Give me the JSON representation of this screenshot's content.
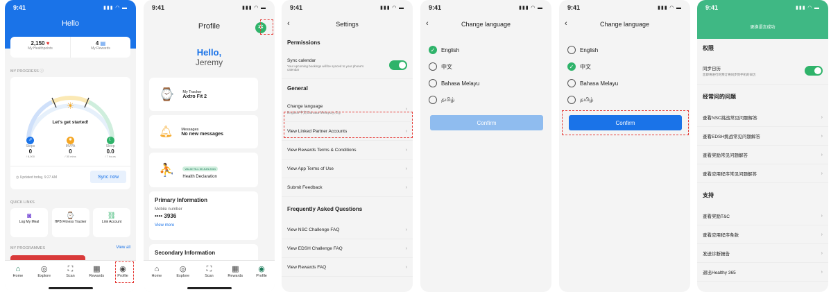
{
  "status_time": "9:41",
  "colors": {
    "brand_blue": "#1a73e8",
    "green": "#2fb36a",
    "teal_header": "#3fb884",
    "highlight": "#e53935"
  },
  "screen1": {
    "header_title": "Hello",
    "healthpoints_value": "2,150",
    "healthpoints_label": "My Healthpoints",
    "rewards_value": "4",
    "rewards_label": "My Rewards",
    "progress_label": "MY PROGRESS",
    "start_text": "Let's get started!",
    "stats": [
      {
        "name": "Steps",
        "value": "0",
        "target": "/ 8,000",
        "icon": "steps-icon",
        "color": "#1a73e8"
      },
      {
        "name": "MVPA",
        "value": "0",
        "target": "/ 30 mins",
        "icon": "flame-icon",
        "color": "#f5a623"
      },
      {
        "name": "Sleep",
        "value": "0.0",
        "target": "/ 7 hours",
        "icon": "moon-icon",
        "color": "#2fb36a"
      }
    ],
    "updated_text": "Updated today, 9:27 AM",
    "sync_label": "Sync now",
    "quick_links_label": "QUICK LINKS",
    "quick_links": [
      {
        "label": "Log My Meal",
        "icon": "meal-icon"
      },
      {
        "label": "HPB Fitness Tracker",
        "icon": "watch-icon"
      },
      {
        "label": "Link Account",
        "icon": "link-icon"
      }
    ],
    "programmes_label": "MY PROGRAMMES",
    "view_all_label": "View all"
  },
  "nav": [
    {
      "label": "Home",
      "icon": "home-icon"
    },
    {
      "label": "Explore",
      "icon": "compass-icon"
    },
    {
      "label": "Scan",
      "icon": "scan-icon"
    },
    {
      "label": "Rewards",
      "icon": "gift-icon"
    },
    {
      "label": "Profile",
      "icon": "profile-icon"
    }
  ],
  "screen2": {
    "title": "Profile",
    "greeting": "Hello,",
    "name": "Jeremy",
    "tracker_label": "My Tracker",
    "tracker_value": "Axtro Fit 2",
    "messages_label": "Messages",
    "messages_value": "No new messages",
    "badge_text": "VALID TILL 30 JUN 2021",
    "health_decl": "Health Declaration",
    "primary_info": "Primary Information",
    "mobile_label": "Mobile number",
    "mobile_value": "•••• 3936",
    "view_more": "View more",
    "secondary_info": "Secondary Information"
  },
  "screen3": {
    "title": "Settings",
    "permissions": "Permissions",
    "sync_calendar": "Sync calendar",
    "sync_desc": "Your upcoming bookings will be synced to your phone's calendar",
    "general": "General",
    "change_language": "Change language",
    "change_language_sub": "English/中文/Bahasa Melayu/தமிழ்",
    "items": [
      "View Linked Partner Accounts",
      "View Rewards Terms & Conditions",
      "View App Terms of Use",
      "Submit Feedback"
    ],
    "faq": "Frequently Asked Questions",
    "faq_items": [
      "View NSC Challenge FAQ",
      "View EDSH Challenge FAQ",
      "View Rewards FAQ"
    ]
  },
  "screen4": {
    "title": "Change language",
    "options": [
      "English",
      "中文",
      "Bahasa Melayu",
      "தமிழ்"
    ],
    "confirm": "Confirm"
  },
  "screen5": {
    "title": "Change language",
    "options": [
      "English",
      "中文",
      "Bahasa Melayu",
      "தமிழ்"
    ],
    "confirm": "Confirm"
  },
  "screen6": {
    "toast": "更换语言成功",
    "permissions": "权限",
    "sync_calendar": "同步日历",
    "sync_desc": "您即将进行的预订将同步到手机的日历",
    "faq": "经常问的问题",
    "faq_items": [
      "查看NSC挑战常见问题解答",
      "查看EDSH挑战常见问题解答",
      "查看奖励常见问题解答",
      "查看应用程序常见问题解答"
    ],
    "support": "支持",
    "support_items": [
      "查看奖励T&C",
      "查看应用程序条款",
      "发送诊断报告",
      "退出Healthy 365"
    ]
  }
}
